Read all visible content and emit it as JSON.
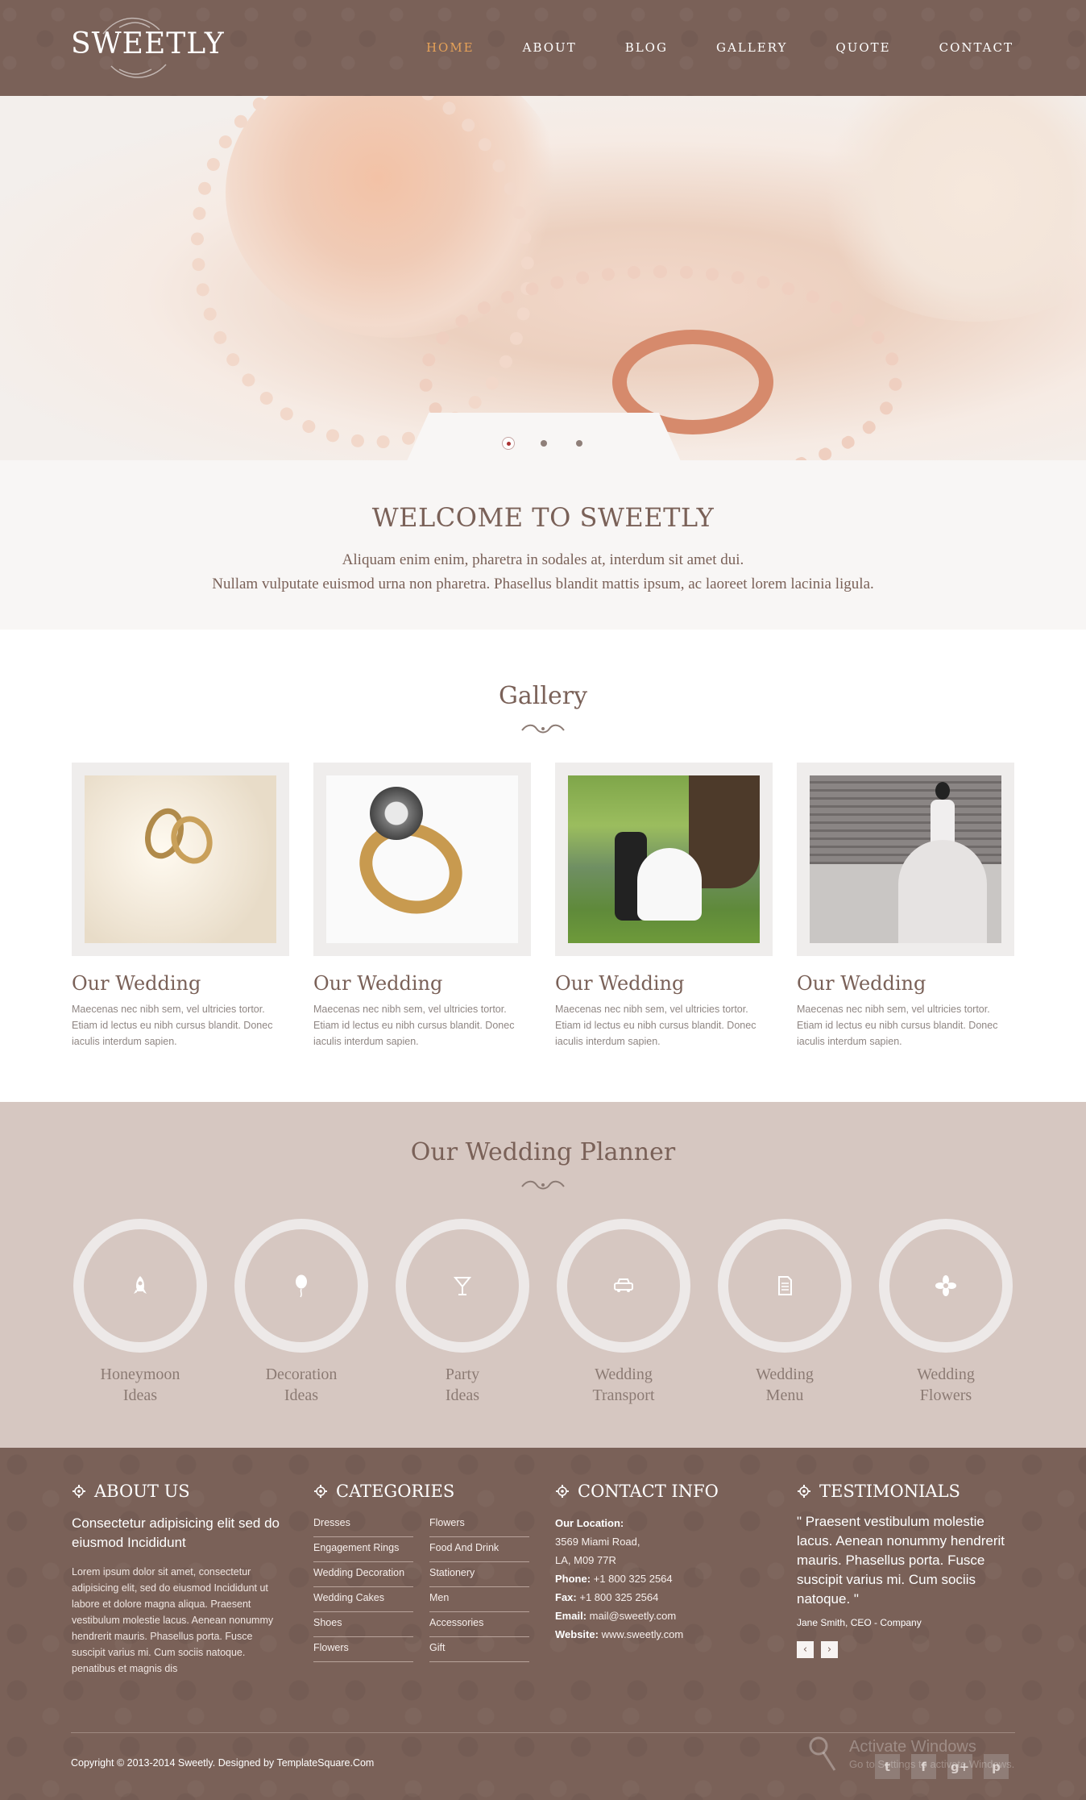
{
  "header": {
    "logo": "SWEETLY",
    "nav": [
      "HOME",
      "ABOUT",
      "BLOG",
      "GALLERY",
      "QUOTE",
      "CONTACT"
    ]
  },
  "hero": {
    "slides": 3,
    "active_slide": 1
  },
  "welcome": {
    "title": "WELCOME TO SWEETLY",
    "line1": "Aliquam enim enim, pharetra in sodales at, interdum sit amet dui.",
    "line2": "Nullam vulputate euismod urna non pharetra. Phasellus blandit mattis ipsum, ac laoreet lorem lacinia ligula."
  },
  "gallery": {
    "title": "Gallery",
    "items": [
      {
        "title": "Our Wedding",
        "text": "Maecenas nec nibh sem, vel ultricies tortor. Etiam id lectus eu nibh cursus blandit. Donec iaculis interdum sapien."
      },
      {
        "title": "Our Wedding",
        "text": "Maecenas nec nibh sem, vel ultricies tortor. Etiam id lectus eu nibh cursus blandit. Donec iaculis interdum sapien."
      },
      {
        "title": "Our Wedding",
        "text": "Maecenas nec nibh sem, vel ultricies tortor. Etiam id lectus eu nibh cursus blandit. Donec iaculis interdum sapien."
      },
      {
        "title": "Our Wedding",
        "text": "Maecenas nec nibh sem, vel ultricies tortor. Etiam id lectus eu nibh cursus blandit. Donec iaculis interdum sapien."
      }
    ]
  },
  "planner": {
    "title": "Our Wedding Planner",
    "items": [
      {
        "line1": "Honeymoon",
        "line2": "Ideas",
        "icon": "rocket-icon"
      },
      {
        "line1": "Decoration",
        "line2": "Ideas",
        "icon": "balloon-icon"
      },
      {
        "line1": "Party",
        "line2": "Ideas",
        "icon": "cocktail-icon"
      },
      {
        "line1": "Wedding",
        "line2": "Transport",
        "icon": "car-icon"
      },
      {
        "line1": "Wedding",
        "line2": "Menu",
        "icon": "document-icon"
      },
      {
        "line1": "Wedding",
        "line2": "Flowers",
        "icon": "flower-icon"
      }
    ]
  },
  "footer": {
    "about": {
      "heading": "ABOUT US",
      "lead": "Consectetur adipisicing elit sed do eiusmod Incididunt",
      "body": "Lorem ipsum dolor sit amet, consectetur adipisicing elit, sed do eiusmod Incididunt ut labore et dolore magna aliqua. Praesent vestibulum molestie lacus. Aenean nonummy hendrerit mauris. Phasellus porta. Fusce suscipit varius mi. Cum sociis natoque. penatibus et magnis dis"
    },
    "categories": {
      "heading": "CATEGORIES",
      "col1": [
        "Dresses",
        "Engagement Rings",
        "Wedding Decoration",
        "Wedding Cakes",
        "Shoes",
        "Flowers"
      ],
      "col2": [
        "Flowers",
        "Food And Drink",
        "Stationery",
        "Men",
        "Accessories",
        "Gift"
      ]
    },
    "contact": {
      "heading": "CONTACT INFO",
      "location_label": "Our Location:",
      "address1": "3569 Miami Road,",
      "address2": "LA, M09 77R",
      "phone_label": "Phone:",
      "phone": "+1 800 325 2564",
      "fax_label": "Fax:",
      "fax": "+1 800 325 2564",
      "email_label": "Email:",
      "email": "mail@sweetly.com",
      "website_label": "Website:",
      "website": "www.sweetly.com"
    },
    "testimonials": {
      "heading": "TESTIMONIALS",
      "quote": "\" Praesent vestibulum molestie lacus. Aenean nonummy hendrerit mauris. Phasellus porta. Fusce suscipit varius mi. Cum sociis natoque. \"",
      "author": "Jane Smith, CEO - Company",
      "prev": "‹",
      "next": "›"
    },
    "copyright_text": "Copyright © 2013-2014 Sweetly. Designed by ",
    "copyright_link": "TemplateSquare.Com",
    "social": [
      "twitter-icon",
      "facebook-icon",
      "google-plus-icon",
      "pinterest-icon"
    ],
    "social_glyphs": [
      "t",
      "f",
      "g+",
      "p"
    ],
    "watermark_line1": "Activate Windows",
    "watermark_line2": "Go to Settings to activate Windows."
  }
}
